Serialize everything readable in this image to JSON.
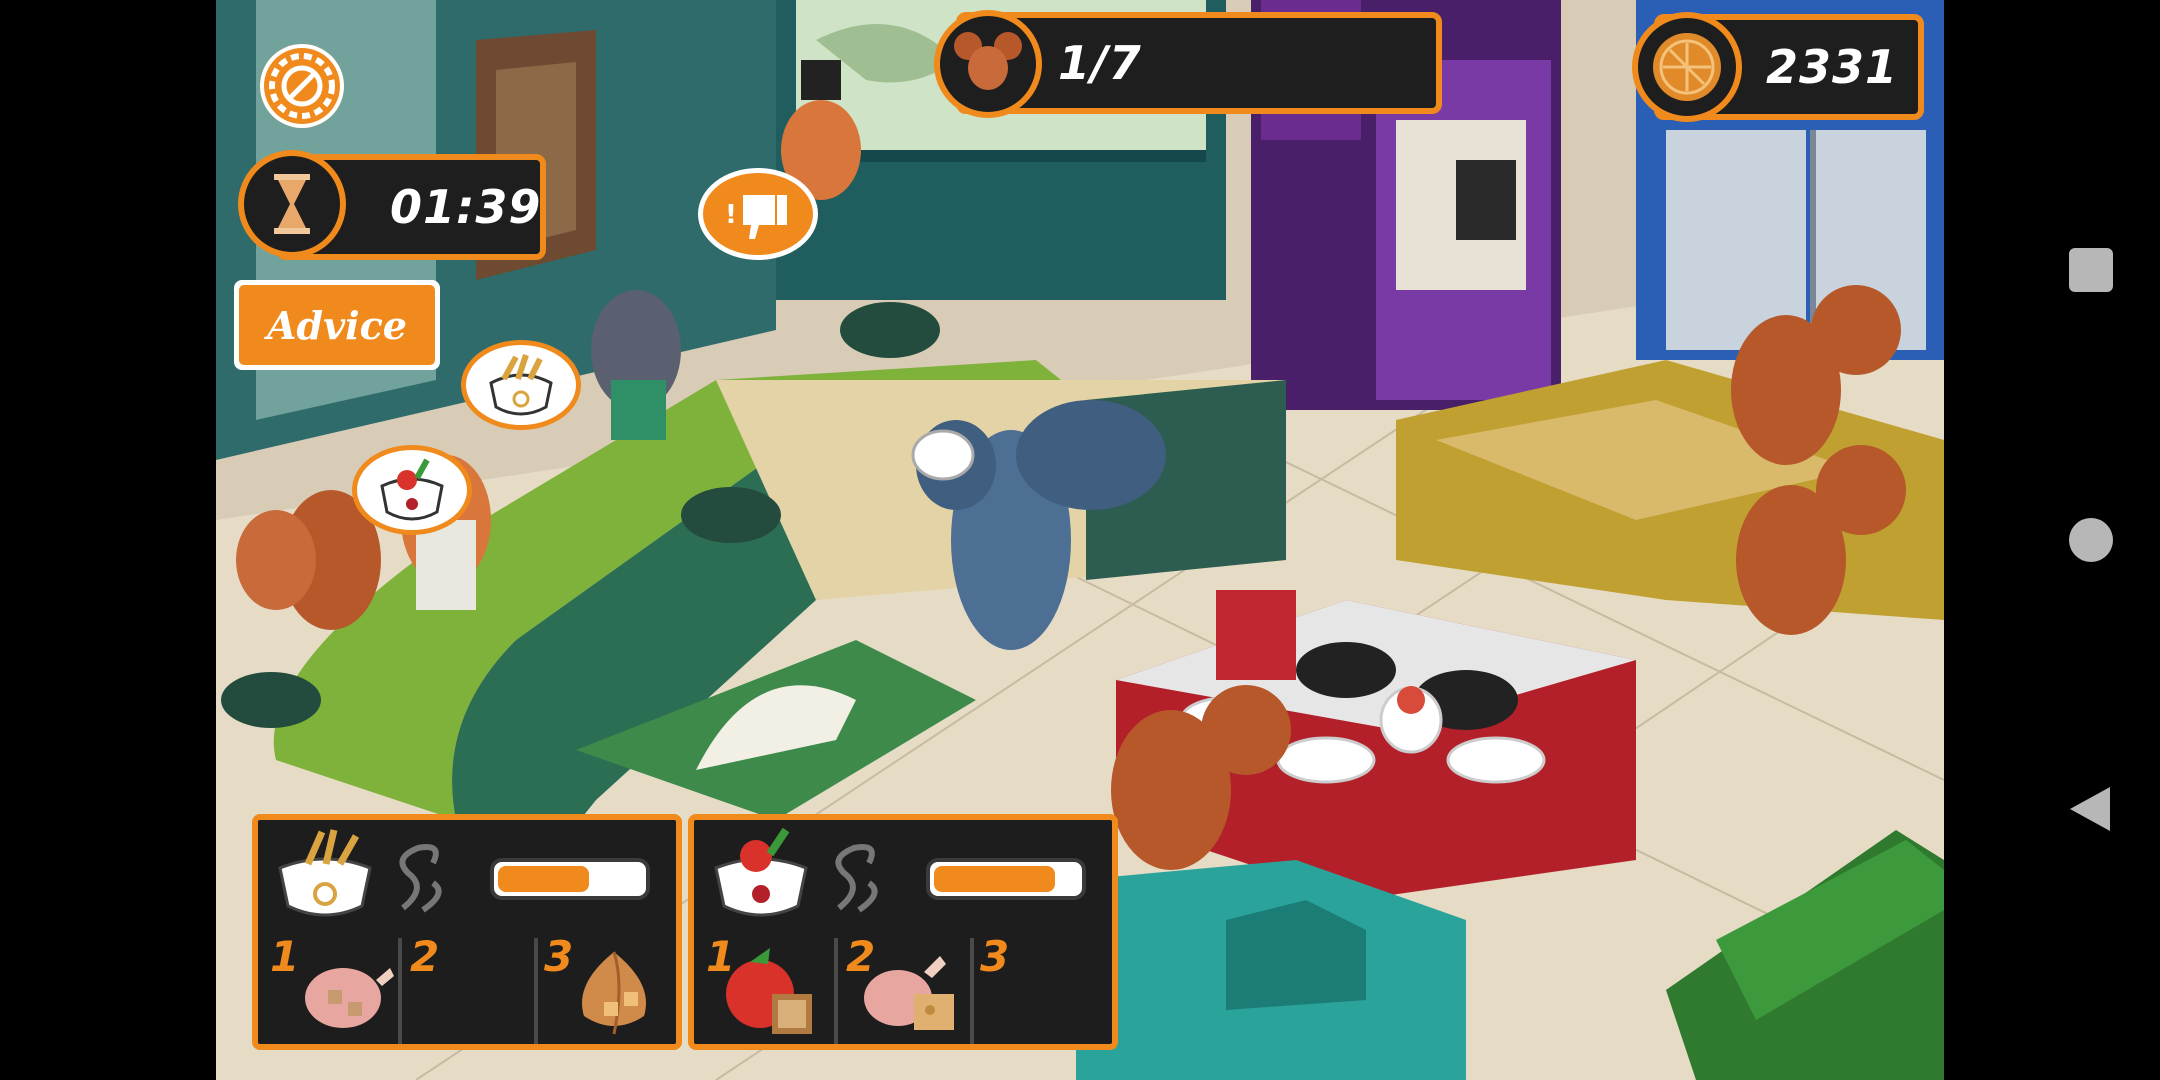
{
  "hud": {
    "timer": "01:39",
    "customers": "1/7",
    "coins": "2331",
    "advice_label": "Advice"
  },
  "orders": [
    {
      "dish_icon": "noodle-bowl-icon",
      "cook_progress": 0.65,
      "ingredients": [
        {
          "num": "1",
          "icon": "chicken-icon"
        },
        {
          "num": "2",
          "icon": ""
        },
        {
          "num": "3",
          "icon": "onion-icon"
        }
      ]
    },
    {
      "dish_icon": "tomato-soup-icon",
      "cook_progress": 0.85,
      "ingredients": [
        {
          "num": "1",
          "icon": "tomato-bread-icon"
        },
        {
          "num": "2",
          "icon": "chicken-cheese-icon"
        },
        {
          "num": "3",
          "icon": ""
        }
      ]
    }
  ],
  "colors": {
    "accent": "#f08a1c",
    "panel": "#1d1d1d",
    "counter_green": "#7fb23a",
    "stove_red": "#b3202a",
    "kiosk_purple": "#6a2d8f",
    "fridge_blue": "#2a5fb5",
    "bin_green": "#2f7a2f"
  },
  "nav": {
    "square": "recent-apps-icon",
    "circle": "home-icon",
    "triangle": "back-icon"
  }
}
